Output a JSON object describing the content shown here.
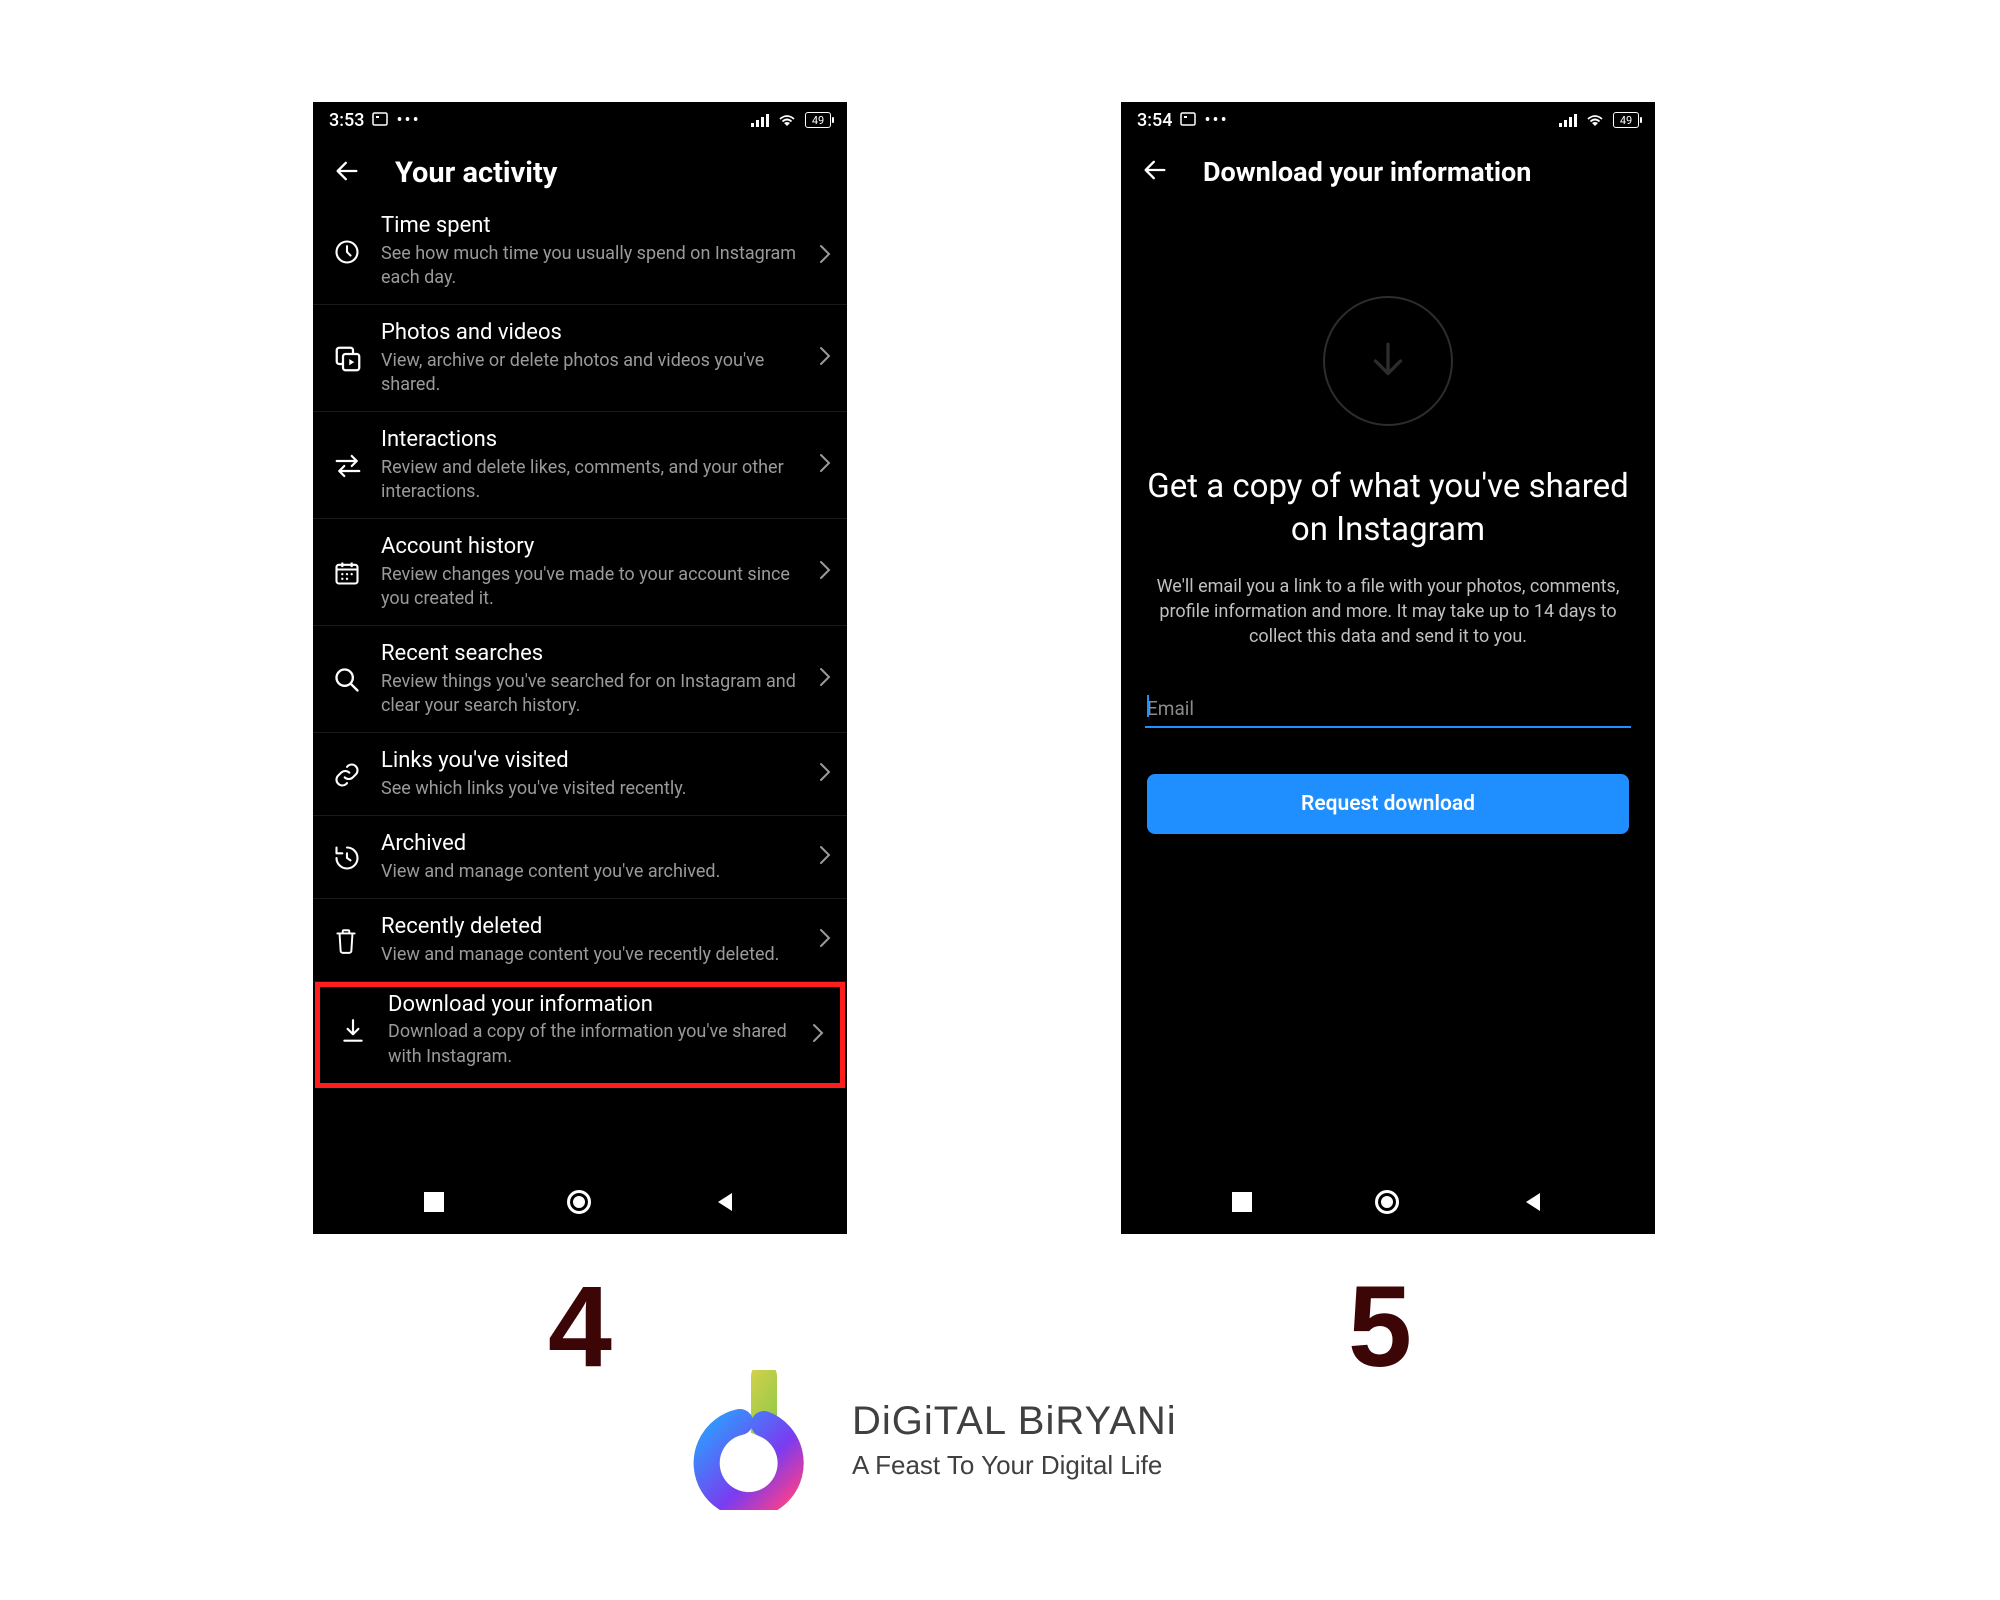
{
  "left": {
    "status": {
      "time": "3:53",
      "battery": "49"
    },
    "header": {
      "title": "Your activity"
    },
    "items": [
      {
        "title": "Time spent",
        "sub": "See how much time you usually spend on Instagram each day."
      },
      {
        "title": "Photos and videos",
        "sub": "View, archive or delete photos and videos you've shared."
      },
      {
        "title": "Interactions",
        "sub": "Review and delete likes, comments, and your other interactions."
      },
      {
        "title": "Account history",
        "sub": "Review changes you've made to your account since you created it."
      },
      {
        "title": "Recent searches",
        "sub": "Review things you've searched for on Instagram and clear your search history."
      },
      {
        "title": "Links you've visited",
        "sub": "See which links you've visited recently."
      },
      {
        "title": "Archived",
        "sub": "View and manage content you've archived."
      },
      {
        "title": "Recently deleted",
        "sub": "View and manage content you've recently deleted."
      },
      {
        "title": "Download your information",
        "sub": "Download a copy of the information you've shared with Instagram."
      }
    ]
  },
  "right": {
    "status": {
      "time": "3:54",
      "battery": "49"
    },
    "header": {
      "title": "Download your information"
    },
    "heading": "Get a copy of what you've shared on Instagram",
    "description": "We'll email you a link to a file with your photos, comments, profile information and more. It may take up to 14 days to collect this data and send it to you.",
    "email_placeholder": "Email",
    "button": "Request download"
  },
  "steps": {
    "four": "4",
    "five": "5"
  },
  "brand": {
    "title": "DiGiTAL BiRYANi",
    "tagline": "A Feast To Your Digital Life"
  }
}
